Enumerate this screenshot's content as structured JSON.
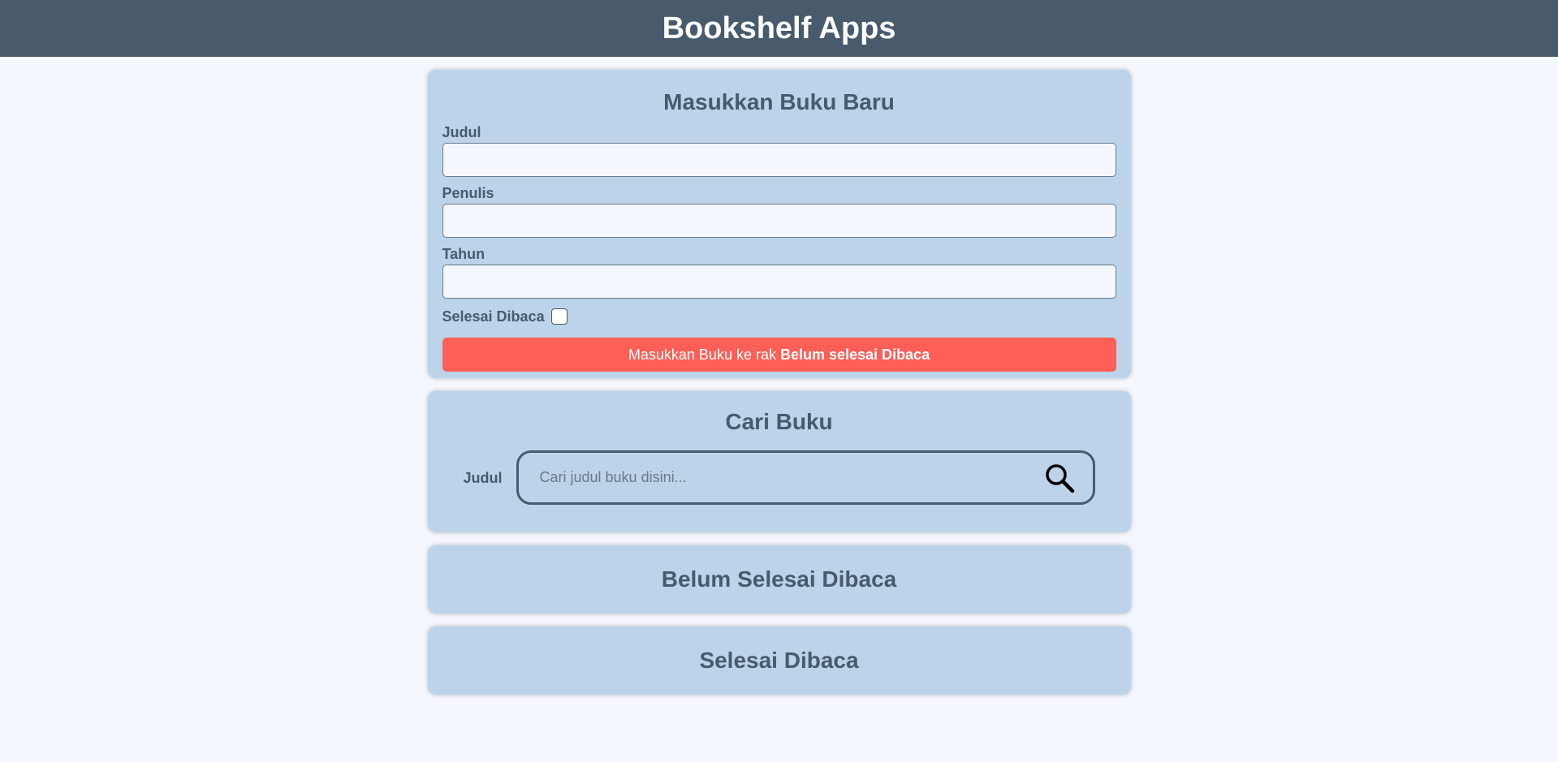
{
  "header": {
    "title": "Bookshelf Apps"
  },
  "input_section": {
    "title": "Masukkan Buku Baru",
    "title_label": "Judul",
    "title_value": "",
    "author_label": "Penulis",
    "author_value": "",
    "year_label": "Tahun",
    "year_value": "",
    "complete_label": "Selesai Dibaca",
    "complete_checked": false,
    "submit_prefix": "Masukkan Buku ke rak",
    "submit_shelf": "Belum selesai Dibaca",
    "submit_color": "#ff5f57"
  },
  "search_section": {
    "title": "Cari Buku",
    "label": "Judul",
    "placeholder": "Cari judul buku disini...",
    "value": "",
    "icon": "search-icon"
  },
  "shelves": {
    "incomplete_title": "Belum Selesai Dibaca",
    "complete_title": "Selesai Dibaca"
  },
  "colors": {
    "header_bg": "#485a6b",
    "card_bg": "#bcd3ea",
    "page_bg": "#f5f7fe",
    "text": "#475b6e"
  }
}
